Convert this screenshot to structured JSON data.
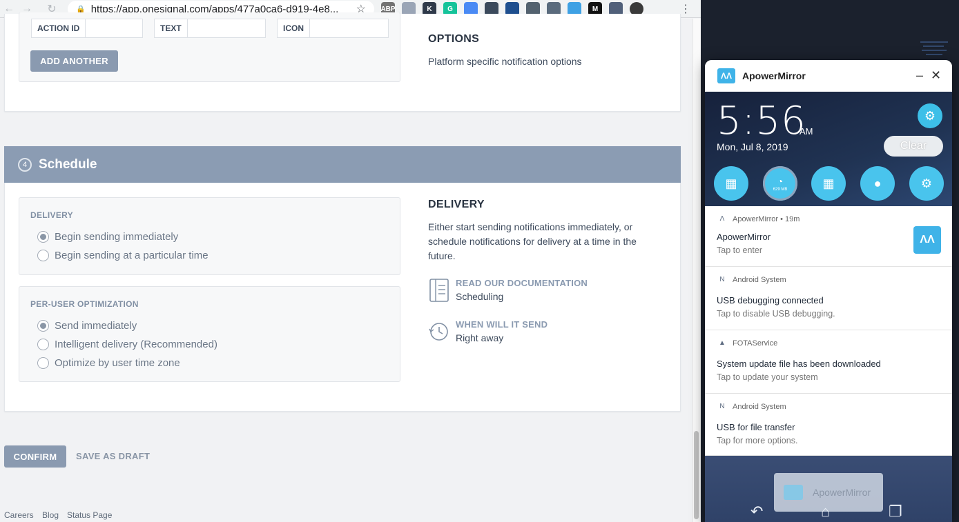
{
  "browser": {
    "url": "https://app.onesignal.com/apps/477a0ca6-d919-4e8...",
    "extensions": [
      {
        "name": "adblock-icon",
        "label": "ABP",
        "color": "#737373"
      },
      {
        "name": "extension-2-icon",
        "label": "",
        "color": "#9aa5b6"
      },
      {
        "name": "extension-k-icon",
        "label": "K",
        "color": "#2f3a4a"
      },
      {
        "name": "grammarly-icon",
        "label": "G",
        "color": "#15c39a"
      },
      {
        "name": "translate-icon",
        "label": "",
        "color": "#4a8af4"
      },
      {
        "name": "feather-icon",
        "label": "",
        "color": "#3b4a5c"
      },
      {
        "name": "extension-7-icon",
        "label": "",
        "color": "#1e4f8f"
      },
      {
        "name": "extension-8-icon",
        "label": "",
        "color": "#53626f"
      },
      {
        "name": "extension-9-icon",
        "label": "",
        "color": "#5a6b7d"
      },
      {
        "name": "extension-10-icon",
        "label": "",
        "color": "#3ea1e4"
      },
      {
        "name": "medium-icon",
        "label": "M",
        "color": "#111111"
      },
      {
        "name": "extension-12-icon",
        "label": "",
        "color": "#51607a"
      },
      {
        "name": "profile-avatar",
        "label": "",
        "color": "#3a3a3a"
      }
    ]
  },
  "buttons_section": {
    "columns": [
      "ACTION ID",
      "TEXT",
      "ICON"
    ],
    "add_another": "ADD ANOTHER",
    "options_heading": "OPTIONS",
    "options_desc": "Platform specific notification options"
  },
  "schedule": {
    "step": "4",
    "title": "Schedule",
    "delivery_label": "DELIVERY",
    "delivery_options": [
      {
        "label": "Begin sending immediately",
        "checked": true
      },
      {
        "label": "Begin sending at a particular time",
        "checked": false
      }
    ],
    "optimization_label": "PER-USER OPTIMIZATION",
    "optimization_options": [
      {
        "label": "Send immediately",
        "checked": true
      },
      {
        "label": "Intelligent delivery (Recommended)",
        "checked": false
      },
      {
        "label": "Optimize by user time zone",
        "checked": false
      }
    ],
    "help_heading": "DELIVERY",
    "help_desc": "Either start sending notifications immediately, or schedule notifications for delivery at a time in the future.",
    "docs_label": "READ OUR DOCUMENTATION",
    "docs_value": "Scheduling",
    "when_label": "WHEN WILL IT SEND",
    "when_value": "Right away"
  },
  "actions": {
    "confirm": "CONFIRM",
    "save_draft": "SAVE AS DRAFT"
  },
  "footer": {
    "links": [
      "Careers",
      "Blog",
      "Status Page"
    ]
  },
  "phone": {
    "app_title": "ApowerMirror",
    "time": "5:56",
    "ampm": "AM",
    "date": "Mon, Jul 8, 2019",
    "clear": "Clear",
    "memory": "629 MB",
    "notifications": [
      {
        "app": "ApowerMirror • 19m",
        "title": "ApowerMirror",
        "sub": "Tap to enter"
      },
      {
        "app": "Android System",
        "title": "USB debugging connected",
        "sub": "Tap to disable USB debugging."
      },
      {
        "app": "FOTAService",
        "title": "System update file has been downloaded",
        "sub": "Tap to update your system"
      },
      {
        "app": "Android System",
        "title": "USB for file transfer",
        "sub": "Tap for more options."
      }
    ],
    "taskbar_label": "ApowerMirror"
  }
}
